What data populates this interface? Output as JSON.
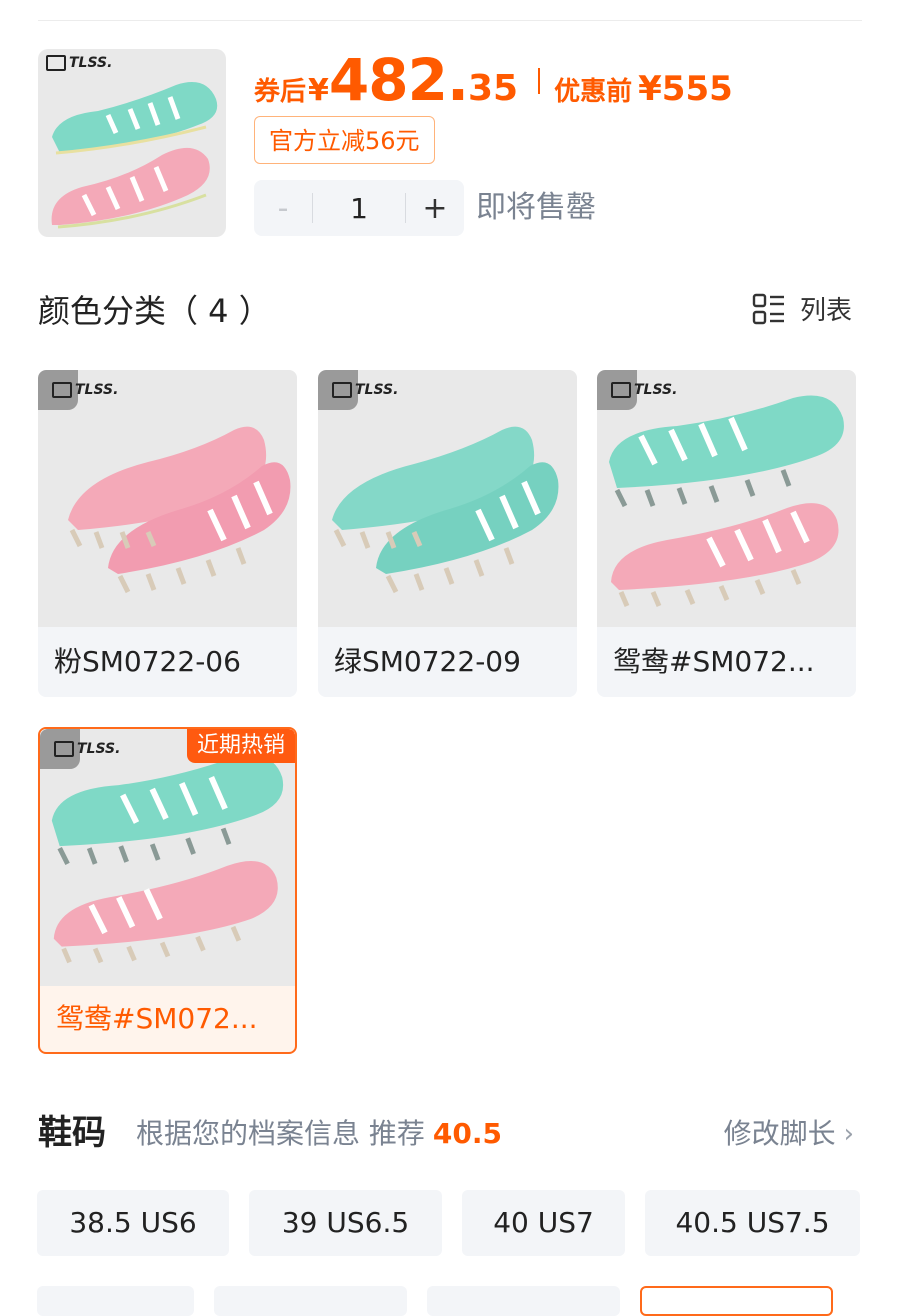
{
  "header": {
    "price_prefix": "券后",
    "currency": "¥",
    "price_int": "482.",
    "price_dec": "35",
    "before_label": "优惠前",
    "before_price": "¥555",
    "coupon_tag": "官方立减56元",
    "quantity": {
      "minus": "-",
      "value": "1",
      "plus": "+"
    },
    "stock_note": "即将售罄"
  },
  "brand_logo_text": "TLSS.",
  "colors": {
    "title": "颜色分类（ 4 ）",
    "view_label": "列表",
    "items": [
      {
        "label": "粉SM0722-06",
        "image": "pink-boots"
      },
      {
        "label": "绿SM0722-09",
        "image": "green-boots"
      },
      {
        "label": "鸳鸯#SM072...",
        "image": "mixed-boots"
      },
      {
        "label": "鸳鸯#SM072...",
        "image": "mixed-boots",
        "badge": "近期热销",
        "selected": true
      }
    ]
  },
  "sizes": {
    "title": "鞋码",
    "hint": "根据您的档案信息 推荐",
    "recommended": "40.5",
    "edit_label": "修改脚长",
    "options": [
      "38.5 US6",
      "39 US6.5",
      "40 US7",
      "40.5 US7.5"
    ]
  },
  "theme": {
    "accent": "#ff5a00",
    "chip_bg": "#f3f5f8",
    "shoe_teal": "#7fd9c6",
    "shoe_pink": "#f4a9b8"
  }
}
